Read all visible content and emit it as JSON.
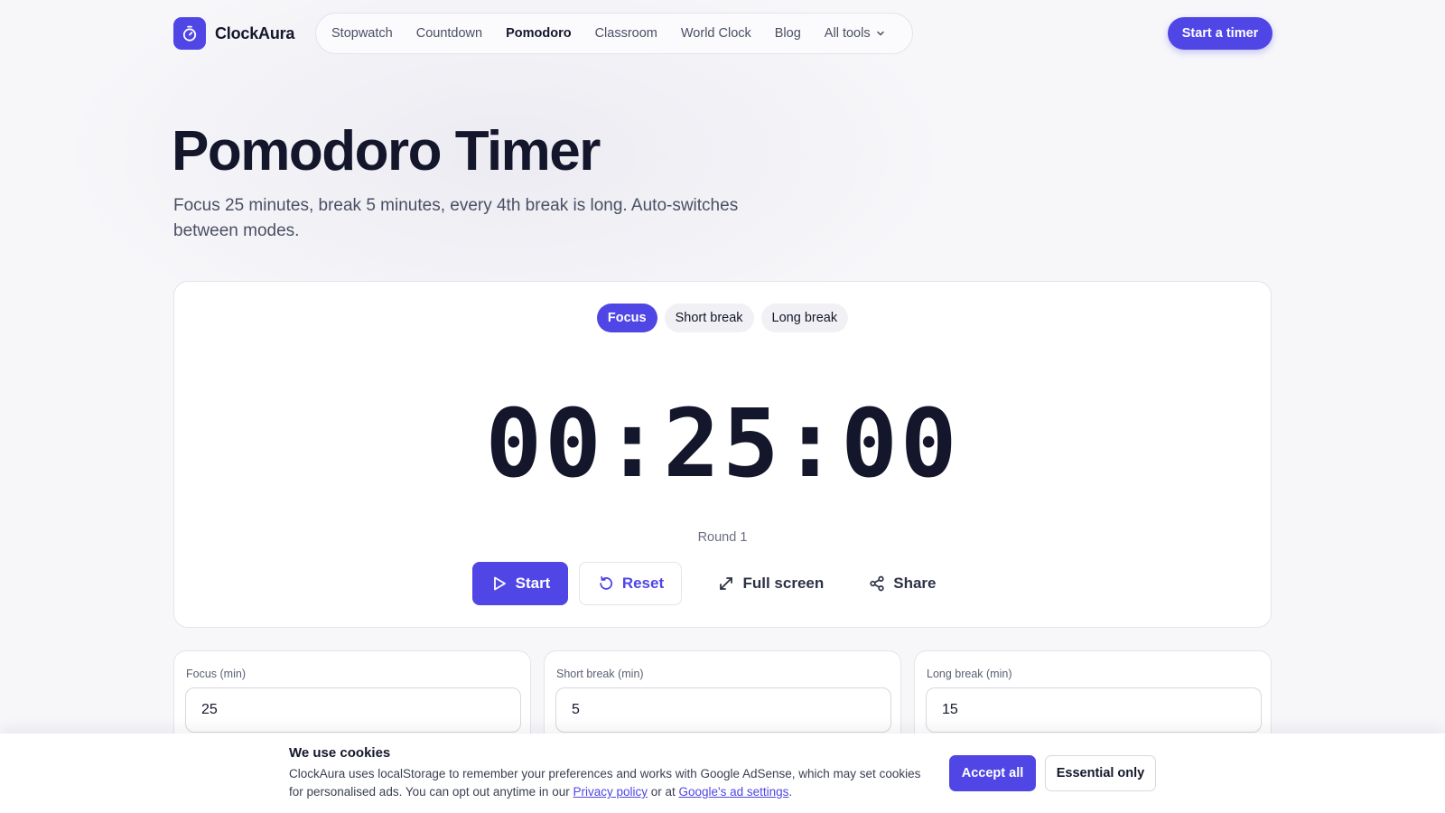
{
  "brand": {
    "name": "ClockAura",
    "logo_icon": "stopwatch-icon",
    "accent": "#4f46e5"
  },
  "nav": {
    "items": [
      "Stopwatch",
      "Countdown",
      "Pomodoro",
      "Classroom",
      "World Clock",
      "Blog"
    ],
    "active": "Pomodoro",
    "more_label": "All tools"
  },
  "header": {
    "cta_label": "Start a timer"
  },
  "hero": {
    "title": "Pomodoro Timer",
    "subtitle": "Focus 25 minutes, break 5 minutes, every 4th break is long. Auto-switches between modes."
  },
  "timer": {
    "modes": [
      "Focus",
      "Short break",
      "Long break"
    ],
    "active_mode": "Focus",
    "display": "00:25:00",
    "round_label": "Round 1",
    "actions": {
      "start": "Start",
      "reset": "Reset",
      "fullscreen": "Full screen",
      "share": "Share"
    }
  },
  "settings": [
    {
      "label": "Focus (min)",
      "value": "25"
    },
    {
      "label": "Short break (min)",
      "value": "5"
    },
    {
      "label": "Long break (min)",
      "value": "15"
    }
  ],
  "cookie": {
    "title": "We use cookies",
    "text_before": "ClockAura uses localStorage to remember your preferences and works with Google AdSense, which may set cookies for personalised ads. You can opt out anytime in our ",
    "privacy_link": "Privacy policy",
    "text_middle": " or at ",
    "ads_link": "Google's ad settings",
    "text_after": ".",
    "accept_label": "Accept all",
    "essential_label": "Essential only"
  }
}
